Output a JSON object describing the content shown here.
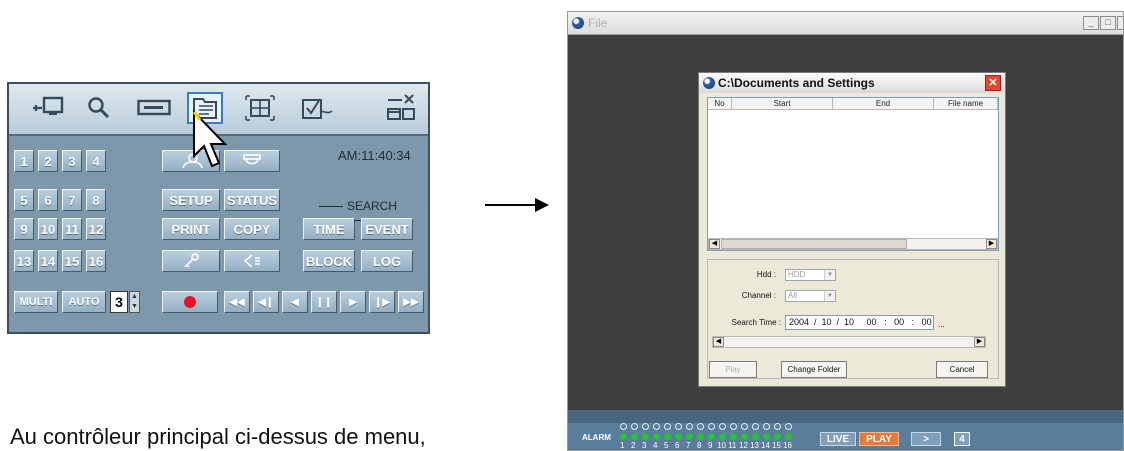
{
  "caption": "Au contrôleur principal ci-dessus de menu,",
  "controller": {
    "clock": "AM:11:40:34",
    "channel_buttons": [
      "1",
      "2",
      "3",
      "4",
      "5",
      "6",
      "7",
      "8",
      "9",
      "10",
      "11",
      "12",
      "13",
      "14",
      "15",
      "16"
    ],
    "setup_label": "SETUP",
    "status_label": "STATUS",
    "print_label": "PRINT",
    "copy_label": "COPY",
    "search_heading": "SEARCH",
    "time_label": "TIME",
    "event_label": "EVENT",
    "block_label": "BLOCK",
    "log_label": "LOG",
    "multi_label": "MULTI",
    "auto_label": "AUTO",
    "split_value": "3"
  },
  "window": {
    "title": "File",
    "dialog": {
      "title": "C:\\Documents and Settings",
      "columns": [
        "No",
        "Start",
        "End",
        "File name"
      ],
      "hdd_label": "Hdd :",
      "hdd_value": "HDD",
      "channel_label": "Channel :",
      "channel_value": "All",
      "search_time_label": "Search Time :",
      "search_time_value": "2004  /  10  /  10     00   :   00   :   00",
      "ellipsis": "...",
      "play_label": "Play",
      "change_folder_label": "Change Folder",
      "cancel_label": "Cancel"
    },
    "strip": {
      "alarm_label": "ALARM",
      "live_label": "LIVE",
      "play_label": "PLAY",
      "next_label": ">",
      "page_value": "4",
      "led_numbers": [
        "1",
        "2",
        "3",
        "4",
        "5",
        "6",
        "7",
        "8",
        "9",
        "10",
        "11",
        "12",
        "13",
        "14",
        "15",
        "16"
      ]
    }
  }
}
